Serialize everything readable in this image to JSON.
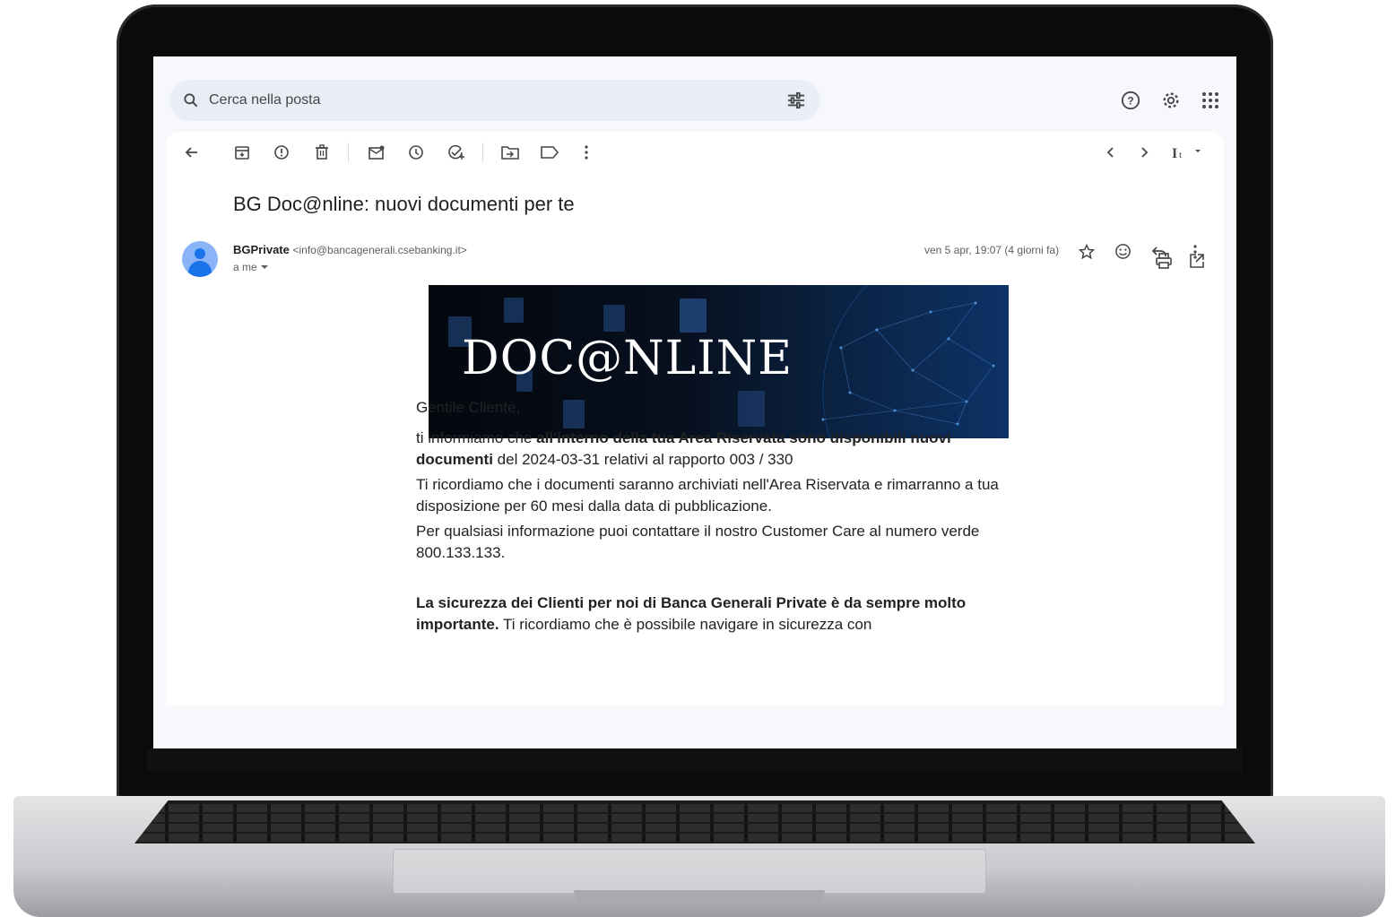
{
  "search": {
    "placeholder": "Cerca nella posta"
  },
  "top_icons": [
    "help-icon",
    "settings-icon",
    "apps-grid-icon"
  ],
  "toolbar": {
    "icons": [
      "back-arrow-icon",
      "archive-icon",
      "report-spam-icon",
      "delete-icon",
      "mark-unread-icon",
      "snooze-icon",
      "add-task-icon",
      "move-to-icon",
      "label-icon",
      "more-vert-icon"
    ],
    "nav_icons": [
      "chevron-left-icon",
      "chevron-right-icon",
      "input-tools-icon"
    ]
  },
  "email": {
    "subject": "BG Doc@nline: nuovi documenti per te",
    "sender_name": "BGPrivate",
    "sender_email": "<info@bancagenerali.csebanking.it>",
    "to": "a me",
    "date": "ven 5 apr, 19:07 (4 giorni fa)",
    "banner_title": "DOC@NLINE",
    "greeting": "Gentile Cliente,",
    "p1_before": "ti informiamo che ",
    "p1_bold": "all'interno della tua Area Riservata sono disponibili nuovi documenti",
    "p1_after": " del 2024-03-31 relativi al rapporto 003 / 330",
    "p2": "Ti ricordiamo che i documenti saranno archiviati nell'Area Riservata e rimarranno a tua disposizione per 60 mesi dalla data di pubblicazione.",
    "p3": "Per qualsiasi informazione puoi contattare il nostro Customer Care al numero verde 800.133.133.",
    "p4_bold": "La sicurezza dei Clienti per noi di Banca Generali Private è da sempre molto importante.",
    "p4_after": " Ti ricordiamo che è possibile navigare in sicurezza con"
  },
  "colors": {
    "search_bg": "#e9eef6",
    "avatar": "#8ab4f8",
    "app_bg": "#f6f8fc"
  }
}
